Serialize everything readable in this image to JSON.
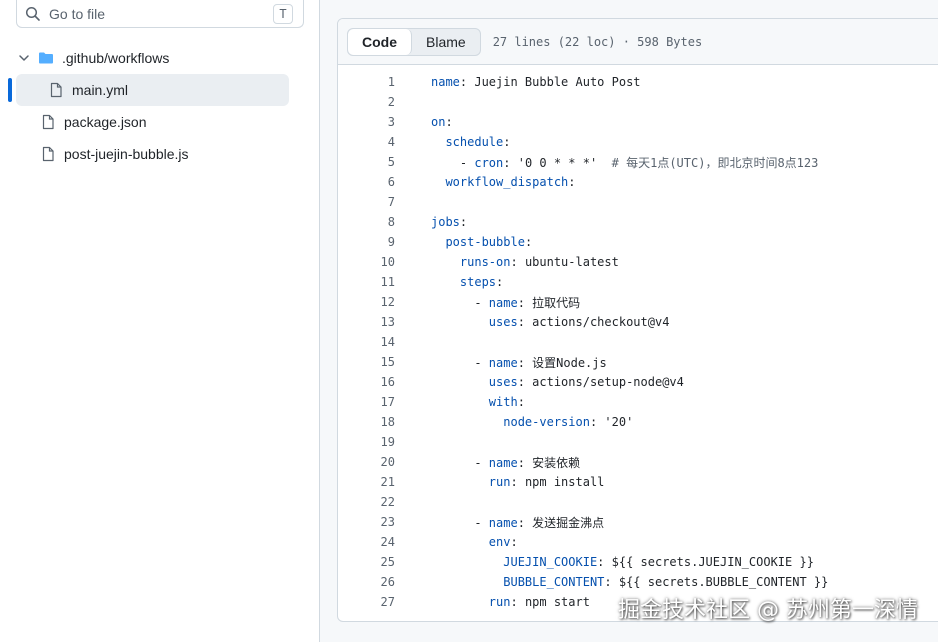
{
  "search": {
    "placeholder": "Go to file",
    "shortcut": "T"
  },
  "tree": [
    {
      "label": ".github/workflows",
      "type": "folder",
      "expanded": true
    },
    {
      "label": "main.yml",
      "type": "file",
      "selected": true
    },
    {
      "label": "package.json",
      "type": "file"
    },
    {
      "label": "post-juejin-bubble.js",
      "type": "file"
    }
  ],
  "viewer": {
    "tabs": {
      "code": "Code",
      "blame": "Blame"
    },
    "meta": "27 lines (22 loc) · 598 Bytes"
  },
  "code": [
    {
      "n": "1",
      "indent": "",
      "key": "name",
      "sep": ": ",
      "val": "Juejin Bubble Auto Post"
    },
    {
      "n": "2",
      "indent": "",
      "key": "",
      "sep": "",
      "val": ""
    },
    {
      "n": "3",
      "indent": "",
      "key": "on",
      "sep": ":",
      "val": ""
    },
    {
      "n": "4",
      "indent": "  ",
      "key": "schedule",
      "sep": ":",
      "val": ""
    },
    {
      "n": "5",
      "indent": "    - ",
      "key": "cron",
      "sep": ": ",
      "val": "'0 0 * * *'",
      "comment": "  # 每天1点(UTC)，即北京时间8点123"
    },
    {
      "n": "6",
      "indent": "  ",
      "key": "workflow_dispatch",
      "sep": ":",
      "val": ""
    },
    {
      "n": "7",
      "indent": "",
      "key": "",
      "sep": "",
      "val": ""
    },
    {
      "n": "8",
      "indent": "",
      "key": "jobs",
      "sep": ":",
      "val": ""
    },
    {
      "n": "9",
      "indent": "  ",
      "key": "post-bubble",
      "sep": ":",
      "val": ""
    },
    {
      "n": "10",
      "indent": "    ",
      "key": "runs-on",
      "sep": ": ",
      "val": "ubuntu-latest"
    },
    {
      "n": "11",
      "indent": "    ",
      "key": "steps",
      "sep": ":",
      "val": ""
    },
    {
      "n": "12",
      "indent": "      - ",
      "key": "name",
      "sep": ": ",
      "val": "拉取代码"
    },
    {
      "n": "13",
      "indent": "        ",
      "key": "uses",
      "sep": ": ",
      "val": "actions/checkout@v4"
    },
    {
      "n": "14",
      "indent": "",
      "key": "",
      "sep": "",
      "val": ""
    },
    {
      "n": "15",
      "indent": "      - ",
      "key": "name",
      "sep": ": ",
      "val": "设置Node.js"
    },
    {
      "n": "16",
      "indent": "        ",
      "key": "uses",
      "sep": ": ",
      "val": "actions/setup-node@v4"
    },
    {
      "n": "17",
      "indent": "        ",
      "key": "with",
      "sep": ":",
      "val": ""
    },
    {
      "n": "18",
      "indent": "          ",
      "key": "node-version",
      "sep": ": ",
      "val": "'20'"
    },
    {
      "n": "19",
      "indent": "",
      "key": "",
      "sep": "",
      "val": ""
    },
    {
      "n": "20",
      "indent": "      - ",
      "key": "name",
      "sep": ": ",
      "val": "安装依赖"
    },
    {
      "n": "21",
      "indent": "        ",
      "key": "run",
      "sep": ": ",
      "val": "npm install"
    },
    {
      "n": "22",
      "indent": "",
      "key": "",
      "sep": "",
      "val": ""
    },
    {
      "n": "23",
      "indent": "      - ",
      "key": "name",
      "sep": ": ",
      "val": "发送掘金沸点"
    },
    {
      "n": "24",
      "indent": "        ",
      "key": "env",
      "sep": ":",
      "val": ""
    },
    {
      "n": "25",
      "indent": "          ",
      "key": "JUEJIN_COOKIE",
      "sep": ": ",
      "val": "${{ secrets.JUEJIN_COOKIE }}"
    },
    {
      "n": "26",
      "indent": "          ",
      "key": "BUBBLE_CONTENT",
      "sep": ": ",
      "val": "${{ secrets.BUBBLE_CONTENT }}"
    },
    {
      "n": "27",
      "indent": "        ",
      "key": "run",
      "sep": ": ",
      "val": "npm start"
    }
  ],
  "watermark": "掘金技术社区 @ 苏州第一深情",
  "colors": {
    "accent": "#0969da",
    "keyword": "#0550ae",
    "folder": "#54aeff"
  }
}
